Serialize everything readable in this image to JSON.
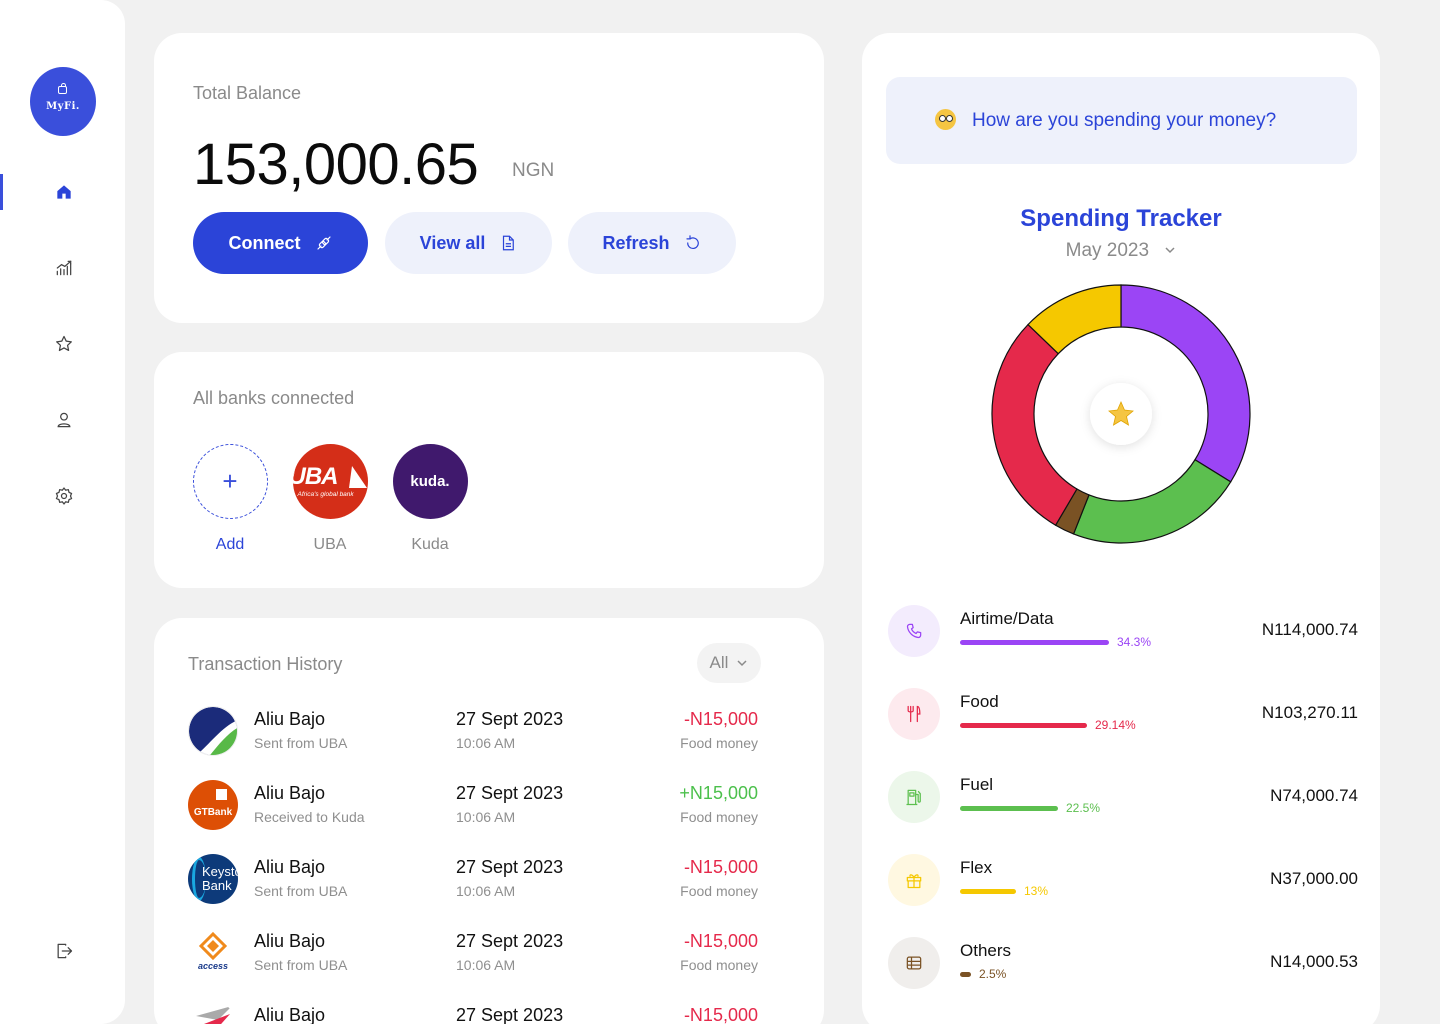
{
  "app": {
    "logo_text": "MyFi."
  },
  "sidebar": {
    "items": [
      {
        "name": "home",
        "icon": "home-icon",
        "active": true
      },
      {
        "name": "analytics",
        "icon": "chart-icon",
        "active": false
      },
      {
        "name": "favorites",
        "icon": "star-icon",
        "active": false
      },
      {
        "name": "profile",
        "icon": "user-icon",
        "active": false
      },
      {
        "name": "settings",
        "icon": "gear-icon",
        "active": false
      }
    ],
    "logout_icon": "logout-icon"
  },
  "balance": {
    "title": "Total Balance",
    "amount": "153,000.65",
    "currency": "NGN",
    "buttons": {
      "connect": "Connect",
      "view_all": "View all",
      "refresh": "Refresh"
    }
  },
  "banks": {
    "title": "All banks connected",
    "items": [
      {
        "label": "Add"
      },
      {
        "label": "UBA",
        "logo_text": "UBA",
        "tagline": "Africa's global bank"
      },
      {
        "label": "Kuda",
        "logo_text": "kuda."
      }
    ]
  },
  "transactions": {
    "title": "Transaction History",
    "filter": "All",
    "rows": [
      {
        "bank": "uba",
        "name": "Aliu Bajo",
        "sub": "Sent from UBA",
        "date": "27 Sept 2023",
        "time": "10:06 AM",
        "amount": "-N15,000",
        "note": "Food money"
      },
      {
        "bank": "gtbank",
        "logo_text": "GTBank",
        "name": "Aliu Bajo",
        "sub": "Received to Kuda",
        "date": "27 Sept 2023",
        "time": "10:06 AM",
        "amount": "+N15,000",
        "note": "Food money"
      },
      {
        "bank": "keystone",
        "logo_text": "Keystone Bank",
        "name": "Aliu Bajo",
        "sub": "Sent from UBA",
        "date": "27 Sept 2023",
        "time": "10:06 AM",
        "amount": "-N15,000",
        "note": "Food money"
      },
      {
        "bank": "access",
        "logo_text": "access",
        "name": "Aliu Bajo",
        "sub": "Sent from UBA",
        "date": "27 Sept 2023",
        "time": "10:06 AM",
        "amount": "-N15,000",
        "note": "Food money"
      },
      {
        "bank": "zenith",
        "name": "Aliu Bajo",
        "sub": "",
        "date": "27 Sept 2023",
        "time": "",
        "amount": "-N15,000",
        "note": ""
      }
    ]
  },
  "spending": {
    "question": "How are you spending your money?",
    "title": "Spending Tracker",
    "month": "May 2023",
    "categories": [
      {
        "name": "Airtime/Data",
        "percent_label": "34.3%",
        "percent": 34.3,
        "amount": "N114,000.74",
        "color": "#9b45f5",
        "icon_bg": "#f3ecfd",
        "icon": "phone-icon"
      },
      {
        "name": "Food",
        "percent_label": "29.14%",
        "percent": 29.14,
        "amount": "N103,270.11",
        "color": "#e5294b",
        "icon_bg": "#fdeaee",
        "icon": "cutlery-icon"
      },
      {
        "name": "Fuel",
        "percent_label": "22.5%",
        "percent": 22.5,
        "amount": "N74,000.74",
        "color": "#5cbf4f",
        "icon_bg": "#ecf7ea",
        "icon": "fuel-icon"
      },
      {
        "name": "Flex",
        "percent_label": "13%",
        "percent": 13,
        "amount": "N37,000.00",
        "color": "#f5c800",
        "icon_bg": "#fff8e1",
        "icon": "gift-icon"
      },
      {
        "name": "Others",
        "percent_label": "2.5%",
        "percent": 2.5,
        "amount": "N14,000.53",
        "color": "#7a5224",
        "icon_bg": "#f0eeec",
        "icon": "list-icon"
      }
    ]
  }
}
